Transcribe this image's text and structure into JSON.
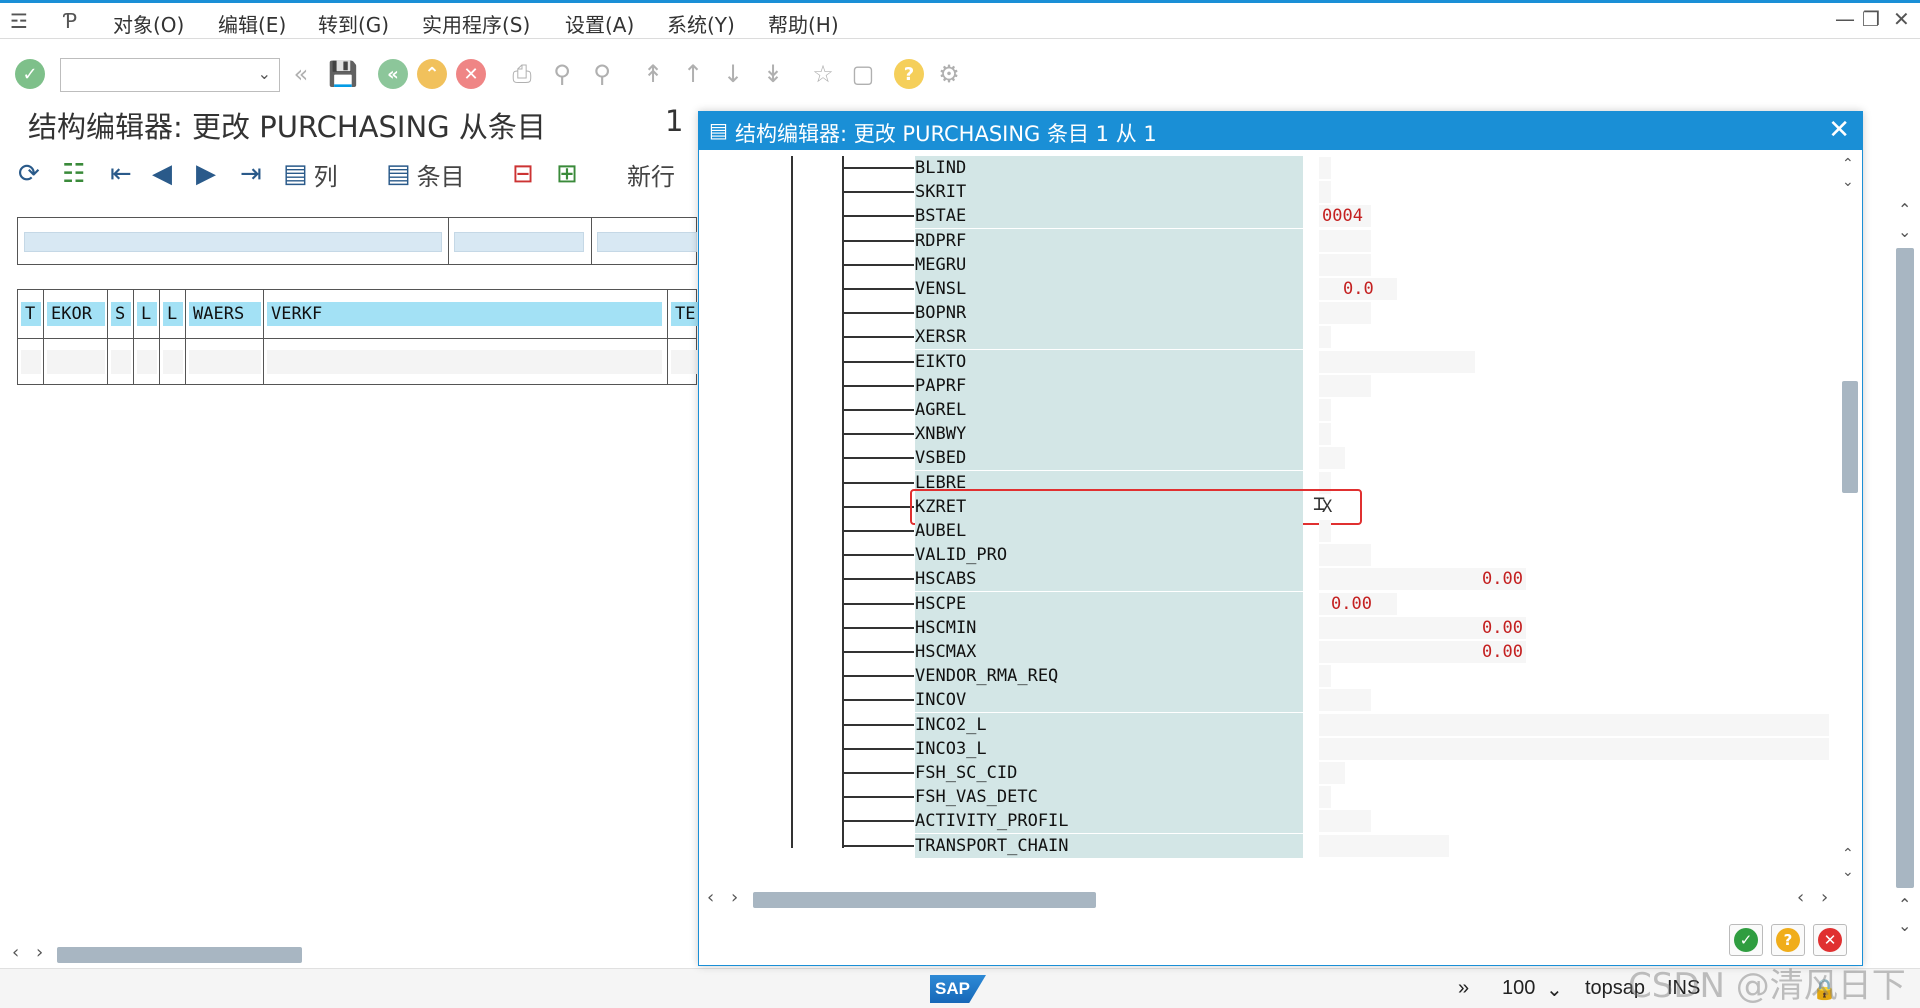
{
  "menu": {
    "items": [
      "对象(O)",
      "编辑(E)",
      "转到(G)",
      "实用程序(S)",
      "设置(A)",
      "系统(Y)",
      "帮助(H)"
    ]
  },
  "main": {
    "title": "结构编辑器: 更改 PURCHASING 从条目",
    "count": "1"
  },
  "app_toolbar": {
    "col_label": "列",
    "entry_label": "条目",
    "new_row_label": "新行"
  },
  "table": {
    "headers": [
      "T",
      "EKOR",
      "S",
      "L",
      "L",
      "WAERS",
      "VERKF",
      "TE"
    ]
  },
  "dialog": {
    "title": "结构编辑器: 更改 PURCHASING 条目 1 从 1",
    "rows": [
      {
        "name": "BLIND",
        "value": ""
      },
      {
        "name": "SKRIT",
        "value": ""
      },
      {
        "name": "BSTAE",
        "value": "0004"
      },
      {
        "name": "RDPRF",
        "value": ""
      },
      {
        "name": "MEGRU",
        "value": ""
      },
      {
        "name": "VENSL",
        "value": "0.0"
      },
      {
        "name": "BOPNR",
        "value": ""
      },
      {
        "name": "XERSR",
        "value": ""
      },
      {
        "name": "EIKTO",
        "value": ""
      },
      {
        "name": "PAPRF",
        "value": ""
      },
      {
        "name": "AGREL",
        "value": ""
      },
      {
        "name": "XNBWY",
        "value": ""
      },
      {
        "name": "VSBED",
        "value": ""
      },
      {
        "name": "LEBRE",
        "value": ""
      },
      {
        "name": "KZRET",
        "value": "X"
      },
      {
        "name": "AUBEL",
        "value": ""
      },
      {
        "name": "VALID_PRO",
        "value": ""
      },
      {
        "name": "HSCABS",
        "value": "0.00"
      },
      {
        "name": "HSCPE",
        "value": "0.00"
      },
      {
        "name": "HSCMIN",
        "value": "0.00"
      },
      {
        "name": "HSCMAX",
        "value": "0.00"
      },
      {
        "name": "VENDOR_RMA_REQ",
        "value": ""
      },
      {
        "name": "INCOV",
        "value": ""
      },
      {
        "name": "INCO2_L",
        "value": ""
      },
      {
        "name": "INCO3_L",
        "value": ""
      },
      {
        "name": "FSH_SC_CID",
        "value": ""
      },
      {
        "name": "FSH_VAS_DETC",
        "value": ""
      },
      {
        "name": "ACTIVITY_PROFIL",
        "value": ""
      },
      {
        "name": "TRANSPORT_CHAIN",
        "value": ""
      }
    ]
  },
  "status": {
    "zoom": "100",
    "system": "topsap",
    "mode": "INS",
    "watermark": "CSDN @清风日下"
  },
  "logo": "SAP"
}
